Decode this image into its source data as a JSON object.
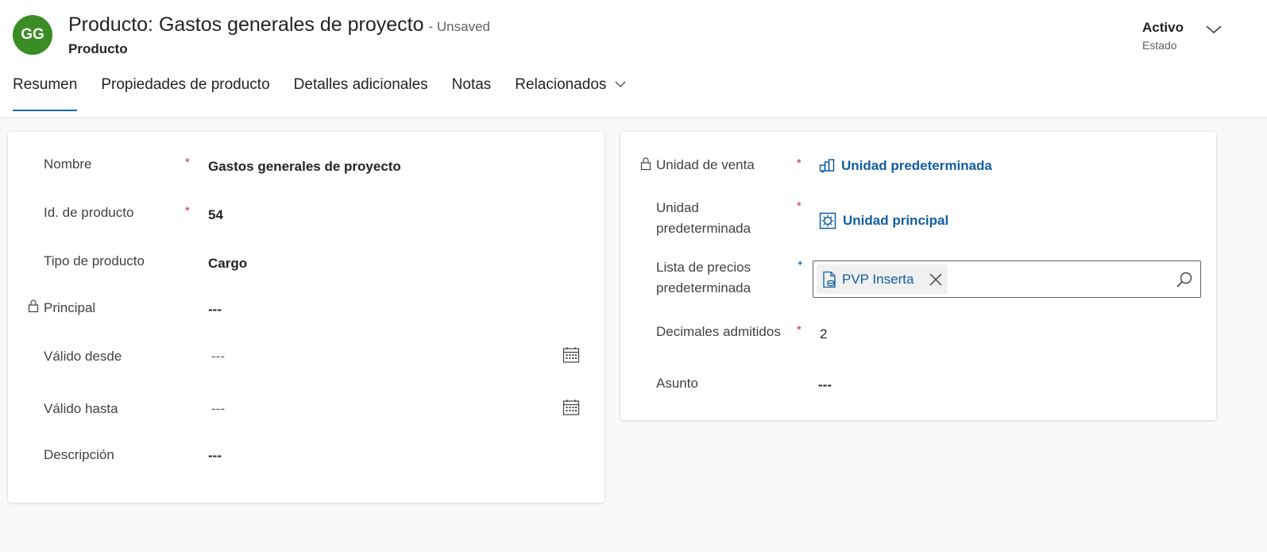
{
  "header": {
    "avatar_initials": "GG",
    "avatar_color": "#3a8c24",
    "title": "Producto: Gastos generales de proyecto",
    "unsaved_label": "- Unsaved",
    "entity_name": "Producto",
    "status_value": "Activo",
    "status_label": "Estado"
  },
  "tabs": [
    {
      "label": "Resumen",
      "active": true
    },
    {
      "label": "Propiedades de producto"
    },
    {
      "label": "Detalles adicionales"
    },
    {
      "label": "Notas"
    },
    {
      "label": "Relacionados",
      "icon": "chevron-down-icon"
    }
  ],
  "left_section": {
    "fields": [
      {
        "label": "Nombre",
        "required": "*",
        "value": "Gastos generales de proyecto"
      },
      {
        "label": "Id. de producto",
        "required": "*",
        "value": "54"
      },
      {
        "label": "Tipo de producto",
        "value": "Cargo"
      },
      {
        "label": "Principal",
        "locked": true,
        "value": "---"
      },
      {
        "label": "Válido desde",
        "value": "---",
        "icon": "calendar-icon"
      },
      {
        "label": "Válido hasta",
        "value": "---",
        "icon": "calendar-icon"
      },
      {
        "label": "Descripción",
        "value": "---"
      }
    ]
  },
  "right_section": {
    "fields": [
      {
        "label": "Unidad de venta",
        "locked": true,
        "required": "*",
        "value": "Unidad predeterminada",
        "icon": "unit-group-icon"
      },
      {
        "label_line1": "Unidad",
        "label_line2": "predeterminada",
        "required": "*",
        "value": "Unidad principal",
        "icon": "unit-icon"
      },
      {
        "label_line1": "Lista de precios",
        "label_line2": "predeterminada",
        "recommended": "+",
        "value": "PVP Inserta",
        "icon": "price-list-icon"
      },
      {
        "label": "Decimales admitidos",
        "required": "*",
        "value": "2"
      },
      {
        "label": "Asunto",
        "value": "---"
      }
    ]
  },
  "colors": {
    "accent": "#0f6cbd",
    "link": "#115ea3",
    "required": "#c4314b"
  }
}
